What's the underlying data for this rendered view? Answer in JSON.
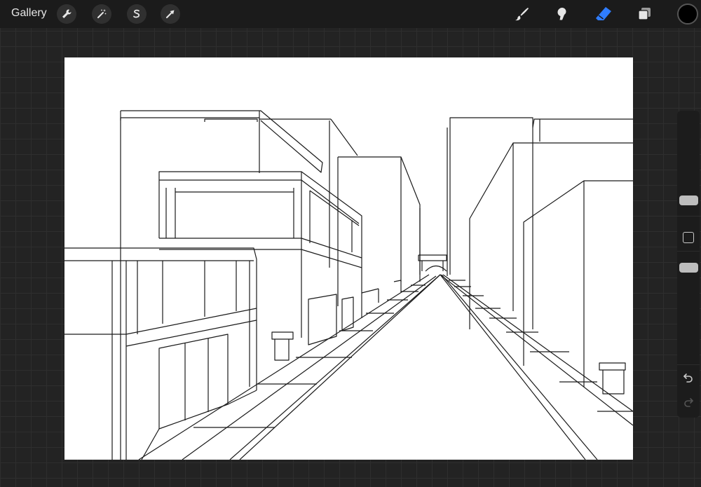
{
  "toolbar": {
    "gallery_label": "Gallery",
    "left_tools": [
      "wrench-icon",
      "magic-wand-icon",
      "selection-icon",
      "transform-icon"
    ],
    "right_tools": [
      "brush-icon",
      "smudge-icon",
      "eraser-icon",
      "layers-icon"
    ],
    "active_tool": "eraser-icon",
    "accent_color": "#2f7dff",
    "current_color": "#000000"
  },
  "sidebar": {
    "controls": [
      "brush-size-slider",
      "modify-button",
      "opacity-slider",
      "undo-button",
      "redo-button"
    ]
  },
  "canvas": {
    "background": "#ffffff",
    "line_color": "#1a1a1a"
  }
}
